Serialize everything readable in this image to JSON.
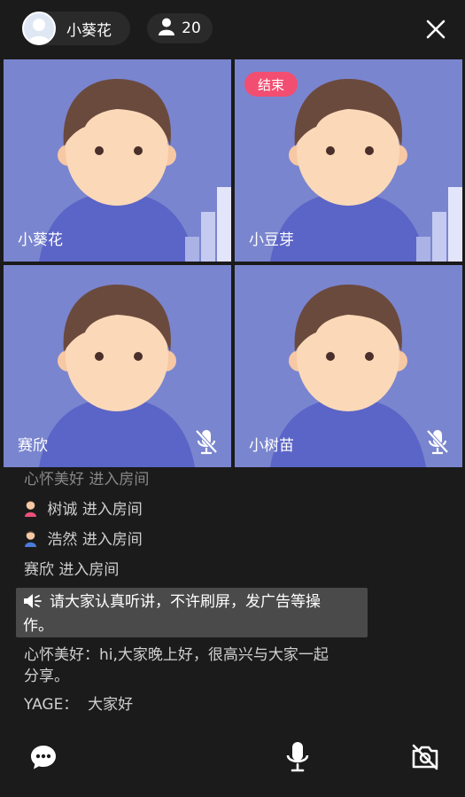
{
  "header": {
    "host_name": "小葵花",
    "viewer_count": "20"
  },
  "tiles": [
    {
      "name": "小葵花",
      "badge": "",
      "state": "volume"
    },
    {
      "name": "小豆芽",
      "badge": "结束",
      "state": "volume"
    },
    {
      "name": "赛欣",
      "badge": "",
      "state": "mic-off"
    },
    {
      "name": "小树苗",
      "badge": "",
      "state": "mic-off"
    }
  ],
  "messages": [
    {
      "user": "心怀美好",
      "text": "进入房间",
      "icon": ""
    },
    {
      "user": "树诚",
      "text": "进入房间",
      "icon": "female-user-icon"
    },
    {
      "user": "浩然",
      "text": "进入房间",
      "icon": "male-user-icon"
    },
    {
      "user": "赛欣",
      "text": "进入房间",
      "icon": ""
    }
  ],
  "notice": {
    "line1": "请大家认真听讲，不许刷屏，发广告等操",
    "line2": "作。"
  },
  "chat": [
    {
      "line1": "心怀美好：hi,大家晚上好，很高兴与大家一起",
      "line2": "分享。"
    },
    {
      "line1": "YAGE：  大家好",
      "line2": ""
    }
  ],
  "colors": {
    "background": "#1b1b1b",
    "tile": "#7a85cf",
    "badge_end": "#f24e71",
    "notice_bg": "#4a4a4a"
  },
  "icons": [
    "user-icon",
    "close-icon",
    "volume-bars-icon",
    "mic-off-icon",
    "speaker-icon",
    "chat-icon",
    "microphone-icon",
    "camera-off-icon"
  ]
}
